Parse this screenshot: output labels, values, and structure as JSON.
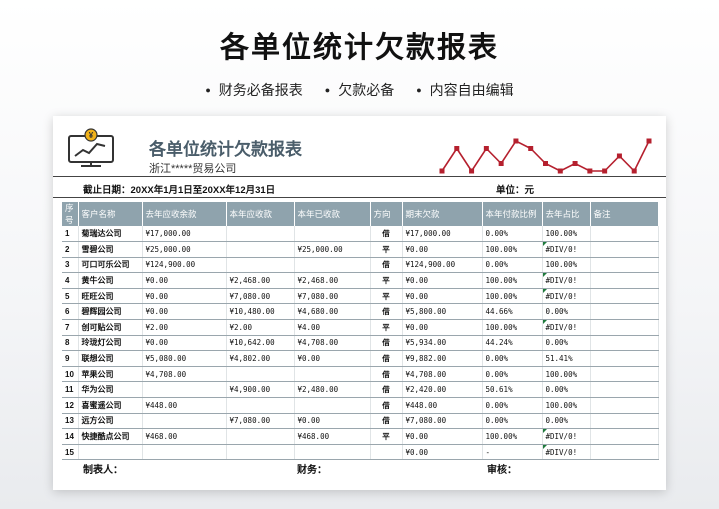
{
  "headline": "各单位统计欠款报表",
  "features": [
    "财务必备报表",
    "欠款必备",
    "内容自由编辑"
  ],
  "sheet": {
    "icon": "yen-chart-icon",
    "title": "各单位统计欠款报表",
    "company": "浙江*****贸易公司",
    "date_label": "截止日期：20XX年1月1日至20XX年12月31日",
    "unit_label": "单位：元",
    "sparkline_color": "#b5202e",
    "header_color": "#8fa3ad",
    "sparkline_points": [
      5,
      2,
      5,
      2,
      4,
      1,
      2,
      4,
      5,
      4,
      5,
      5,
      3,
      5,
      1
    ],
    "columns": [
      "序号",
      "客户名称",
      "去年应收余款",
      "本年应收款",
      "本年已收款",
      "方向",
      "期末欠款",
      "本年付款比例",
      "去年占比",
      "备注"
    ],
    "rows": [
      {
        "seq": "1",
        "name": "菊瑞达公司",
        "prev": "¥17,000.00",
        "recv": "",
        "paid": "",
        "dir": "借",
        "end": "¥17,000.00",
        "ratio": "0.00%",
        "share": "100.00%",
        "err": false
      },
      {
        "seq": "2",
        "name": "雪碧公司",
        "prev": "¥25,000.00",
        "recv": "",
        "paid": "¥25,000.00",
        "dir": "平",
        "end": "¥0.00",
        "ratio": "100.00%",
        "share": "#DIV/0!",
        "err": true
      },
      {
        "seq": "3",
        "name": "可口可乐公司",
        "prev": "¥124,900.00",
        "recv": "",
        "paid": "",
        "dir": "借",
        "end": "¥124,900.00",
        "ratio": "0.00%",
        "share": "100.00%",
        "err": false
      },
      {
        "seq": "4",
        "name": "黄牛公司",
        "prev": "¥0.00",
        "recv": "¥2,468.00",
        "paid": "¥2,468.00",
        "dir": "平",
        "end": "¥0.00",
        "ratio": "100.00%",
        "share": "#DIV/0!",
        "err": true
      },
      {
        "seq": "5",
        "name": "旺旺公司",
        "prev": "¥0.00",
        "recv": "¥7,080.00",
        "paid": "¥7,080.00",
        "dir": "平",
        "end": "¥0.00",
        "ratio": "100.00%",
        "share": "#DIV/0!",
        "err": true
      },
      {
        "seq": "6",
        "name": "碧辉园公司",
        "prev": "¥0.00",
        "recv": "¥10,480.00",
        "paid": "¥4,680.00",
        "dir": "借",
        "end": "¥5,800.00",
        "ratio": "44.66%",
        "share": "0.00%",
        "err": false
      },
      {
        "seq": "7",
        "name": "创可贴公司",
        "prev": "¥2.00",
        "recv": "¥2.00",
        "paid": "¥4.00",
        "dir": "平",
        "end": "¥0.00",
        "ratio": "100.00%",
        "share": "#DIV/0!",
        "err": true
      },
      {
        "seq": "8",
        "name": "玲珑灯公司",
        "prev": "¥0.00",
        "recv": "¥10,642.00",
        "paid": "¥4,708.00",
        "dir": "借",
        "end": "¥5,934.00",
        "ratio": "44.24%",
        "share": "0.00%",
        "err": false
      },
      {
        "seq": "9",
        "name": "联想公司",
        "prev": "¥5,080.00",
        "recv": "¥4,802.00",
        "paid": "¥0.00",
        "dir": "借",
        "end": "¥9,882.00",
        "ratio": "0.00%",
        "share": "51.41%",
        "err": false
      },
      {
        "seq": "10",
        "name": "苹果公司",
        "prev": "¥4,708.00",
        "recv": "",
        "paid": "",
        "dir": "借",
        "end": "¥4,708.00",
        "ratio": "0.00%",
        "share": "100.00%",
        "err": false
      },
      {
        "seq": "11",
        "name": "华为公司",
        "prev": "",
        "recv": "¥4,900.00",
        "paid": "¥2,480.00",
        "dir": "借",
        "end": "¥2,420.00",
        "ratio": "50.61%",
        "share": "0.00%",
        "err": false
      },
      {
        "seq": "12",
        "name": "喜蜜遥公司",
        "prev": "¥448.00",
        "recv": "",
        "paid": "",
        "dir": "借",
        "end": "¥448.00",
        "ratio": "0.00%",
        "share": "100.00%",
        "err": false
      },
      {
        "seq": "13",
        "name": "远方公司",
        "prev": "",
        "recv": "¥7,080.00",
        "paid": "¥0.00",
        "dir": "借",
        "end": "¥7,080.00",
        "ratio": "0.00%",
        "share": "0.00%",
        "err": false
      },
      {
        "seq": "14",
        "name": "快捷酷点公司",
        "prev": "¥468.00",
        "recv": "",
        "paid": "¥468.00",
        "dir": "平",
        "end": "¥0.00",
        "ratio": "100.00%",
        "share": "#DIV/0!",
        "err": true
      },
      {
        "seq": "15",
        "name": "",
        "prev": "",
        "recv": "",
        "paid": "",
        "dir": "",
        "end": "¥0.00",
        "ratio": "-",
        "share": "#DIV/0!",
        "err": true
      }
    ],
    "footer": {
      "maker": "制表人：",
      "finance": "财务：",
      "audit": "审核："
    }
  }
}
